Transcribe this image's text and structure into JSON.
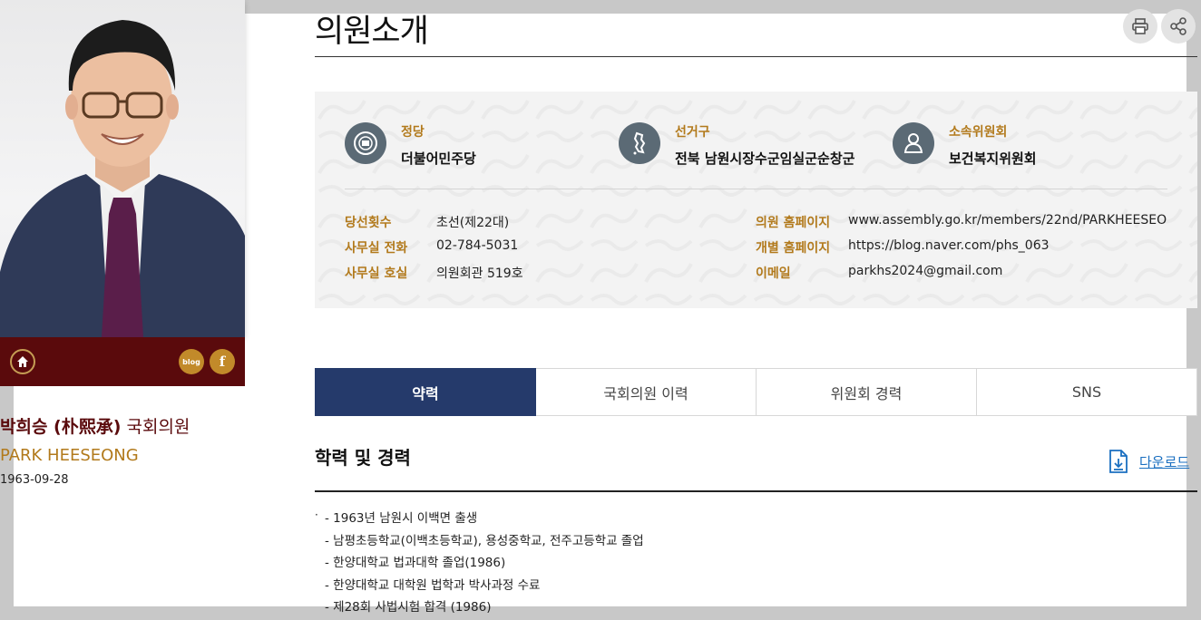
{
  "page_title": "의원소개",
  "member": {
    "name_ko": "박희승 (朴熙承)",
    "title": "국회의원",
    "name_en": "PARK HEESEONG",
    "birth": "1963-09-28"
  },
  "photo_bar": {
    "blog_label": "blog",
    "facebook_label": "f"
  },
  "summary": {
    "party_label": "정당",
    "party": "더불어민주당",
    "district_label": "선거구",
    "district": "전북 남원시장수군임실군순창군",
    "committee_label": "소속위원회",
    "committee": "보건복지위원회"
  },
  "details": {
    "terms_label": "당선횟수",
    "terms": "초선(제22대)",
    "phone_label": "사무실 전화",
    "phone": "02-784-5031",
    "room_label": "사무실 호실",
    "room": "의원회관 519호",
    "homepage_label": "의원 홈페이지",
    "homepage": "www.assembly.go.kr/members/22nd/PARKHEESEONG",
    "personal_label": "개별 홈페이지",
    "personal": "https://blog.naver.com/phs_063",
    "email_label": "이메일",
    "email": "parkhs2024@gmail.com"
  },
  "tabs": [
    {
      "label": "약력",
      "active": true
    },
    {
      "label": "국회의원 이력",
      "active": false
    },
    {
      "label": "위원회 경력",
      "active": false
    },
    {
      "label": "SNS",
      "active": false
    }
  ],
  "section": {
    "title": "학력 및 경력",
    "download_label": "다운로드",
    "bullet": "·",
    "items": [
      "- 1963년 남원시 이백면 출생",
      "- 남평초등학교(이백초등학교), 용성중학교, 전주고등학교 졸업",
      "- 한양대학교 법과대학 졸업(1986)",
      "- 한양대학교 대학원 법학과 박사과정 수료",
      "- 제28회 사법시험 합격 (1986)"
    ]
  },
  "colors": {
    "accent_maroon": "#5a0a0c",
    "accent_gold": "#b27a1c",
    "tab_active": "#253a6b",
    "link_blue": "#1a6fc0"
  }
}
